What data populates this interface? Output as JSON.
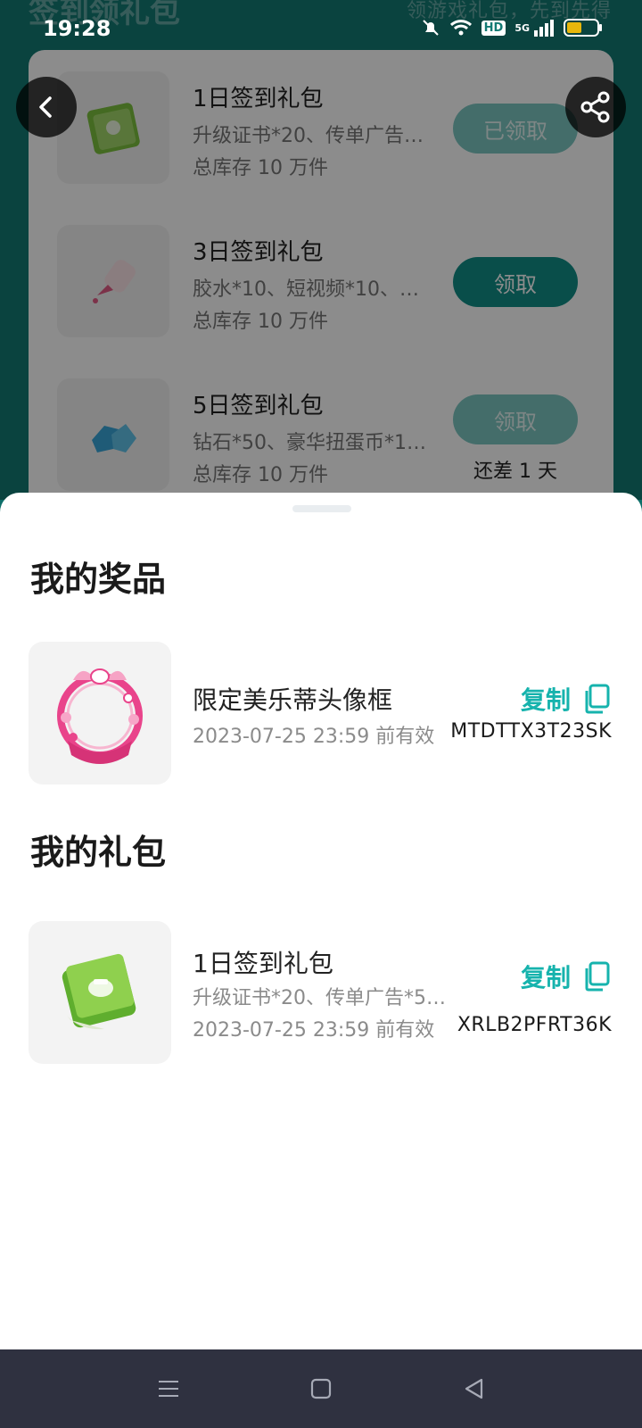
{
  "status": {
    "time": "19:28",
    "network": "5G",
    "hd": "HD"
  },
  "background": {
    "title": "签到领礼包",
    "subtitle": "领游戏礼包，先到先得",
    "gifts": [
      {
        "name": "1日签到礼包",
        "desc": "升级证书*20、传单广告…",
        "stock": "总库存 10 万件",
        "button": "已领取",
        "icon": "green-book-icon"
      },
      {
        "name": "3日签到礼包",
        "desc": "胶水*10、短视频*10、…",
        "stock": "总库存 10 万件",
        "button": "领取",
        "icon": "glue-icon"
      },
      {
        "name": "5日签到礼包",
        "desc": "钻石*50、豪华扭蛋币*1…",
        "stock": "总库存 10 万件",
        "button": "领取",
        "remain": "还差 1 天",
        "icon": "diamond-icon"
      }
    ]
  },
  "sheet": {
    "prizes_title": "我的奖品",
    "prize": {
      "name": "限定美乐蒂头像框",
      "date": "2023-07-25 23:59 前有效",
      "copy_label": "复制",
      "code": "MTDTTX3T23SK",
      "icon": "melody-frame-icon"
    },
    "packs_title": "我的礼包",
    "pack": {
      "name": "1日签到礼包",
      "desc": "升级证书*20、传单广告*5…",
      "date": "2023-07-25 23:59 前有效",
      "copy_label": "复制",
      "code": "XRLB2PFRT36K",
      "icon": "green-book-icon"
    }
  },
  "colors": {
    "accent": "#16b3ad",
    "teal_bg": "#137a74",
    "navbar": "#2f3140"
  }
}
